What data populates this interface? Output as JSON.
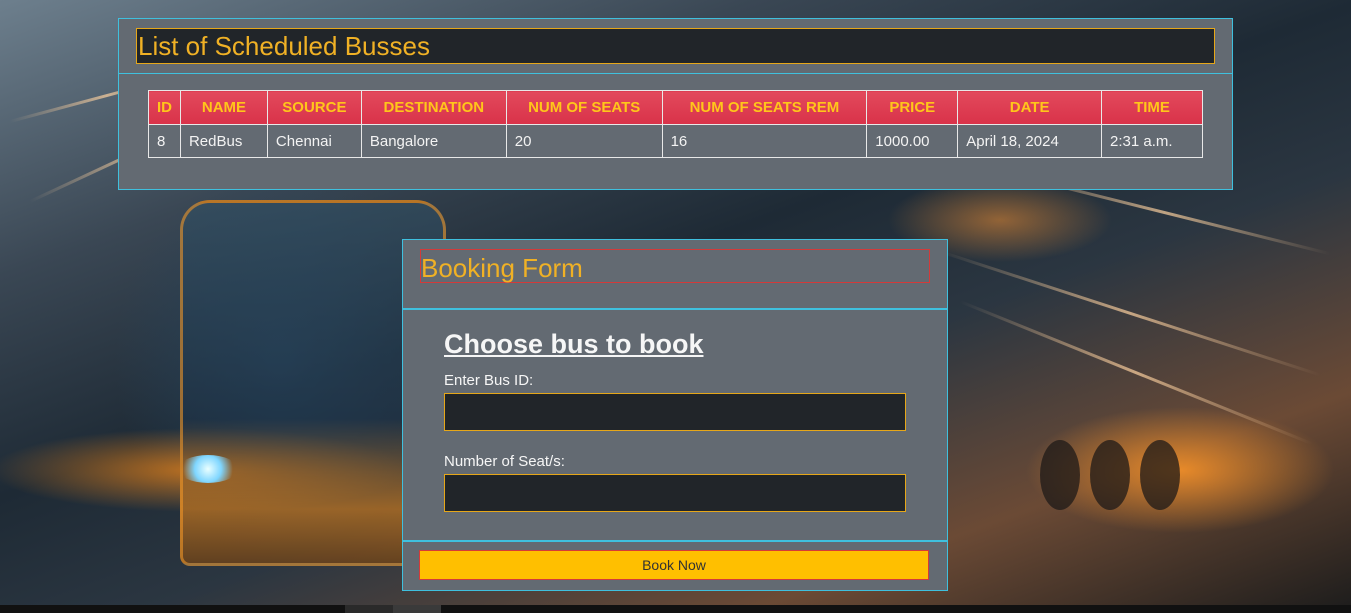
{
  "list_panel": {
    "title": "List of Scheduled Busses",
    "columns": [
      "ID",
      "NAME",
      "SOURCE",
      "DESTINATION",
      "NUM OF SEATS",
      "NUM OF SEATS REM",
      "PRICE",
      "DATE",
      "TIME"
    ],
    "rows": [
      [
        "8",
        "RedBus",
        "Chennai",
        "Bangalore",
        "20",
        "16",
        "1000.00",
        "April 18, 2024",
        "2:31 a.m."
      ]
    ]
  },
  "booking_form": {
    "title": "Booking Form",
    "heading": "Choose bus to book",
    "bus_id_label": "Enter Bus ID:",
    "bus_id_value": "",
    "seats_label": "Number of Seat/s:",
    "seats_value": "",
    "submit_label": "Book Now"
  },
  "colors": {
    "panel_bg": "#636a72",
    "panel_border": "#3fc0de",
    "title_text": "#f0b125",
    "table_header_bg": "#dc3545",
    "table_header_text": "#ffc61a",
    "button_bg": "#ffbf00"
  }
}
